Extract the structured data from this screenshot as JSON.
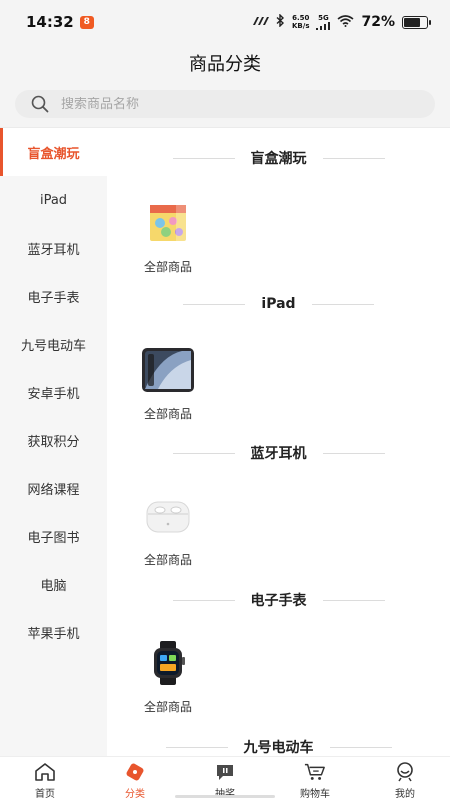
{
  "status_bar": {
    "time": "14:32",
    "app_badge": "8",
    "net_speed_value": "6.50",
    "net_speed_unit": "KB/s",
    "signal_label": "5G",
    "battery_percent": "72%",
    "battery_level": 0.72
  },
  "header": {
    "title": "商品分类"
  },
  "search": {
    "placeholder": "搜索商品名称"
  },
  "sidebar": {
    "items": [
      {
        "label": "盲盒潮玩",
        "active": true
      },
      {
        "label": "iPad"
      },
      {
        "label": "蓝牙耳机"
      },
      {
        "label": "电子手表"
      },
      {
        "label": "九号电动车"
      },
      {
        "label": "安卓手机"
      },
      {
        "label": "获取积分"
      },
      {
        "label": "网络课程"
      },
      {
        "label": "电子图书"
      },
      {
        "label": "电脑"
      },
      {
        "label": "苹果手机"
      }
    ]
  },
  "content": {
    "sections": [
      {
        "title": "盲盒潮玩",
        "item_label": "全部商品",
        "image": "blind-box-image"
      },
      {
        "title": "iPad",
        "item_label": "全部商品",
        "image": "ipad-image"
      },
      {
        "title": "蓝牙耳机",
        "item_label": "全部商品",
        "image": "earbuds-image"
      },
      {
        "title": "电子手表",
        "item_label": "全部商品",
        "image": "smartwatch-image"
      },
      {
        "title": "九号电动车"
      }
    ]
  },
  "tabbar": {
    "tabs": [
      {
        "label": "首页",
        "icon": "home-icon"
      },
      {
        "label": "分类",
        "icon": "category-icon",
        "active": true
      },
      {
        "label": "抽奖",
        "icon": "lottery-icon"
      },
      {
        "label": "购物车",
        "icon": "cart-icon"
      },
      {
        "label": "我的",
        "icon": "profile-icon"
      }
    ]
  },
  "colors": {
    "accent": "#e8552d",
    "sidebar_bg": "#f6f6f6",
    "header_bg": "#f4f4f4"
  }
}
